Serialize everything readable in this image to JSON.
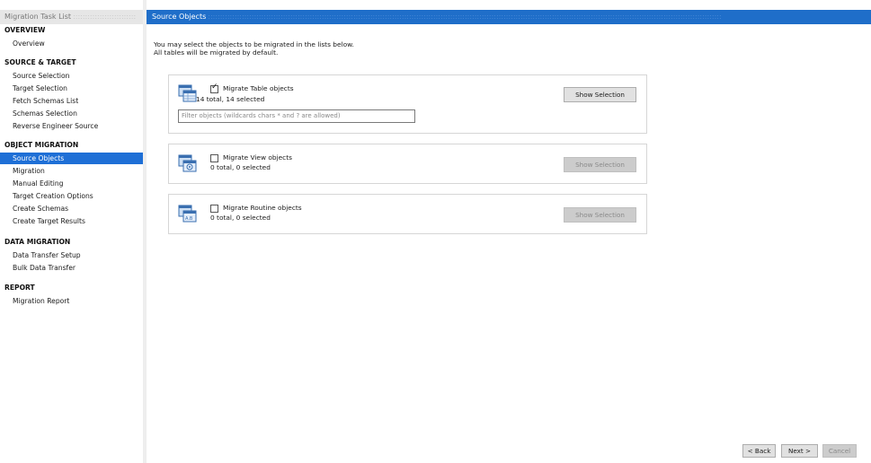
{
  "sidebar": {
    "header": "Migration Task List",
    "sections": [
      {
        "title": "OVERVIEW",
        "items": [
          "Overview"
        ]
      },
      {
        "title": "SOURCE & TARGET",
        "items": [
          "Source Selection",
          "Target Selection",
          "Fetch Schemas List",
          "Schemas Selection",
          "Reverse Engineer Source"
        ]
      },
      {
        "title": "OBJECT MIGRATION",
        "items": [
          "Source Objects",
          "Migration",
          "Manual Editing",
          "Target Creation Options",
          "Create Schemas",
          "Create Target Results"
        ]
      },
      {
        "title": "DATA MIGRATION",
        "items": [
          "Data Transfer Setup",
          "Bulk Data Transfer"
        ]
      },
      {
        "title": "REPORT",
        "items": [
          "Migration Report"
        ]
      }
    ],
    "selected_item": "Source Objects"
  },
  "main": {
    "title": "Source Objects",
    "intro_line1": "You may select the objects to be migrated in the lists below.",
    "intro_line2": "All tables will be migrated by default.",
    "panels": [
      {
        "label": "Migrate Table objects",
        "checked": true,
        "count": "14 total,  14 selected",
        "button": "Show Selection",
        "button_enabled": true,
        "filter_placeholder": "Filter objects (wildcards chars * and ? are allowed)",
        "icon": "table-objects-icon"
      },
      {
        "label": "Migrate View objects",
        "checked": false,
        "count": "0 total, 0 selected",
        "button": "Show Selection",
        "button_enabled": false,
        "icon": "view-objects-icon"
      },
      {
        "label": "Migrate Routine objects",
        "checked": false,
        "count": "0 total, 0 selected",
        "button": "Show Selection",
        "button_enabled": false,
        "icon": "routine-objects-icon"
      }
    ]
  },
  "footer": {
    "back": "< Back",
    "next": "Next >",
    "cancel": "Cancel"
  },
  "colors": {
    "accent": "#1f6ec9",
    "selected": "#1e6fd6"
  }
}
